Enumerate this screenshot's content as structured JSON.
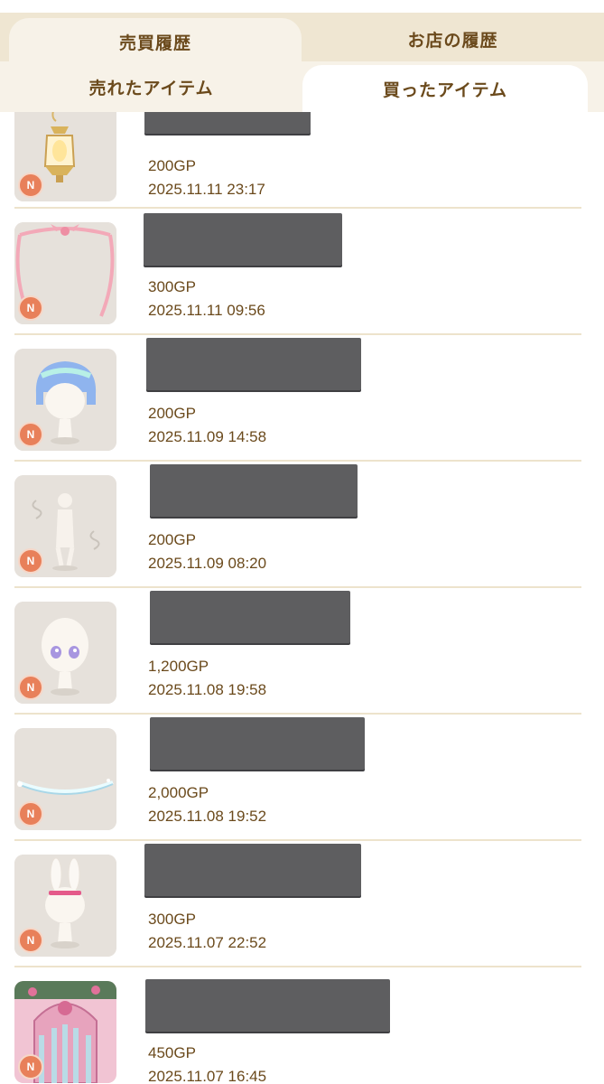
{
  "tabs": {
    "main": [
      {
        "label": "売買履歴",
        "active": true
      },
      {
        "label": "お店の履歴",
        "active": false
      }
    ],
    "sub": [
      {
        "label": "売れたアイテム",
        "active": false
      },
      {
        "label": "買ったアイテム",
        "active": true
      }
    ]
  },
  "items": [
    {
      "price": "200GP",
      "date": "2025.11.11 23:17",
      "rarity": "N",
      "icon": "lantern-item"
    },
    {
      "price": "300GP",
      "date": "2025.11.11 09:56",
      "rarity": "N",
      "icon": "ribbon-frame-item"
    },
    {
      "price": "200GP",
      "date": "2025.11.09 14:58",
      "rarity": "N",
      "icon": "blue-hair-item"
    },
    {
      "price": "200GP",
      "date": "2025.11.09 08:20",
      "rarity": "N",
      "icon": "smoke-effect-item"
    },
    {
      "price": "1,200GP",
      "date": "2025.11.08 19:58",
      "rarity": "N",
      "icon": "eyes-item"
    },
    {
      "price": "2,000GP",
      "date": "2025.11.08 19:52",
      "rarity": "N",
      "icon": "halo-ring-item"
    },
    {
      "price": "300GP",
      "date": "2025.11.07 22:52",
      "rarity": "N",
      "icon": "bunny-ears-item"
    },
    {
      "price": "450GP",
      "date": "2025.11.07 16:45",
      "rarity": "N",
      "icon": "rose-window-room-item"
    }
  ],
  "colors": {
    "text_brown": "#6b4a1c",
    "tab_bg": "#efe6d2",
    "rarity_badge": "#e8805a",
    "redaction": "#5e5e60"
  }
}
